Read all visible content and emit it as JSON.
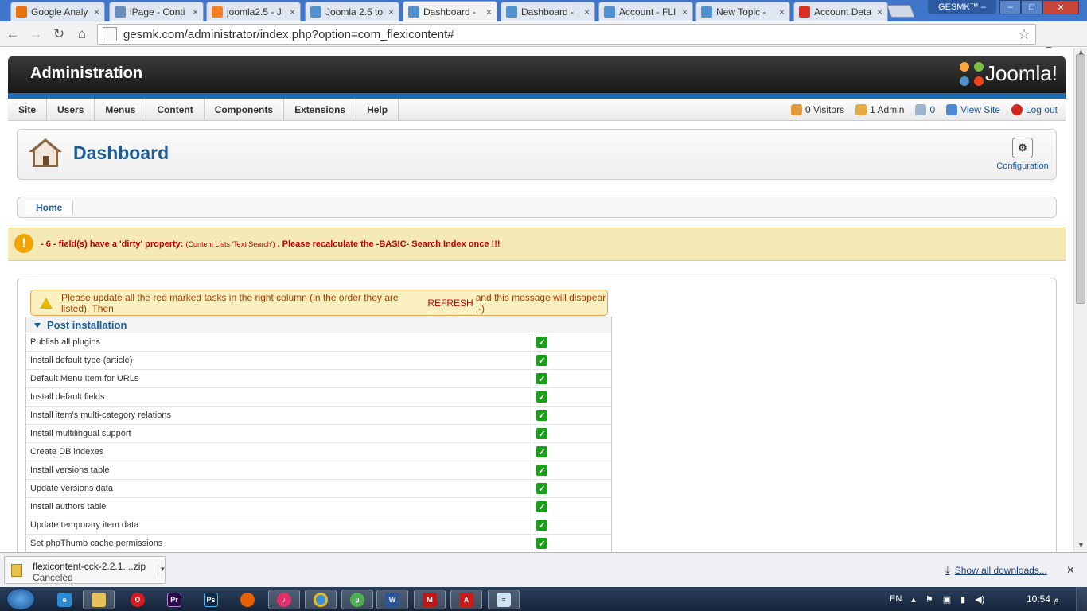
{
  "browser": {
    "tabs": [
      {
        "label": "Google Analy",
        "icon": "analytics-icon",
        "color": "#e8710a",
        "active": false
      },
      {
        "label": "iPage - Conti",
        "icon": "ipage-icon",
        "color": "#6c8ebf",
        "active": false
      },
      {
        "label": "joomla2.5 - J",
        "icon": "stackoverflow-icon",
        "color": "#f48024",
        "active": false
      },
      {
        "label": "Joomla 2.5 to",
        "icon": "joomla-icon",
        "color": "#5091cd",
        "active": false
      },
      {
        "label": "Dashboard -",
        "icon": "joomla-icon",
        "color": "#5091cd",
        "active": true
      },
      {
        "label": "Dashboard -",
        "icon": "joomla-icon",
        "color": "#5091cd",
        "active": false
      },
      {
        "label": "Account - FLI",
        "icon": "joomla-icon",
        "color": "#5091cd",
        "active": false
      },
      {
        "label": "New Topic -",
        "icon": "joomla-icon",
        "color": "#5091cd",
        "active": false
      },
      {
        "label": "Account Deta",
        "icon": "gmail-icon",
        "color": "#d93025",
        "active": false
      }
    ],
    "tab_close": "×",
    "profile": "GESMK™ –",
    "url": "gesmk.com/administrator/index.php?option=com_flexicontent#"
  },
  "joomla": {
    "header_title": "Administration",
    "logo_text": "Joomla!",
    "menu": [
      "Site",
      "Users",
      "Menus",
      "Content",
      "Components",
      "Extensions",
      "Help"
    ],
    "status": {
      "visitors": "0 Visitors",
      "admin": "1 Admin",
      "messages": "0",
      "view_site": "View Site",
      "logout": "Log out"
    },
    "page_title": "Dashboard",
    "configuration_label": "Configuration",
    "breadcrumb_home": "Home",
    "warning": {
      "part1": "- 6 - field(s) have a 'dirty' property: ",
      "part2": "(Content Lists 'Text Search')",
      "part3": " . Please recalculate the -BASIC- Search Index once !!!"
    },
    "notice": {
      "before": "Please update all the red marked tasks in the right column (in the order they are listed). Then",
      "refresh": "REFRESH",
      "after": "and this message will disapear ;-)"
    },
    "post_install_title": "Post installation",
    "tasks": [
      "Publish all plugins",
      "Install default type (article)",
      "Default Menu Item for URLs",
      "Install default fields",
      "Install item's multi-category relations",
      "Install multilingual support",
      "Create DB indexes",
      "Install versions table",
      "Update versions data",
      "Install authors table",
      "Update temporary item data",
      "Set phpThumb cache permissions"
    ],
    "task_status": "✓"
  },
  "downloads": {
    "file": "flexicontent-cck-2.2.1....zip",
    "status": "Canceled",
    "show_all": "Show all downloads..."
  },
  "taskbar": {
    "lang": "EN",
    "time": "10:54 م"
  }
}
